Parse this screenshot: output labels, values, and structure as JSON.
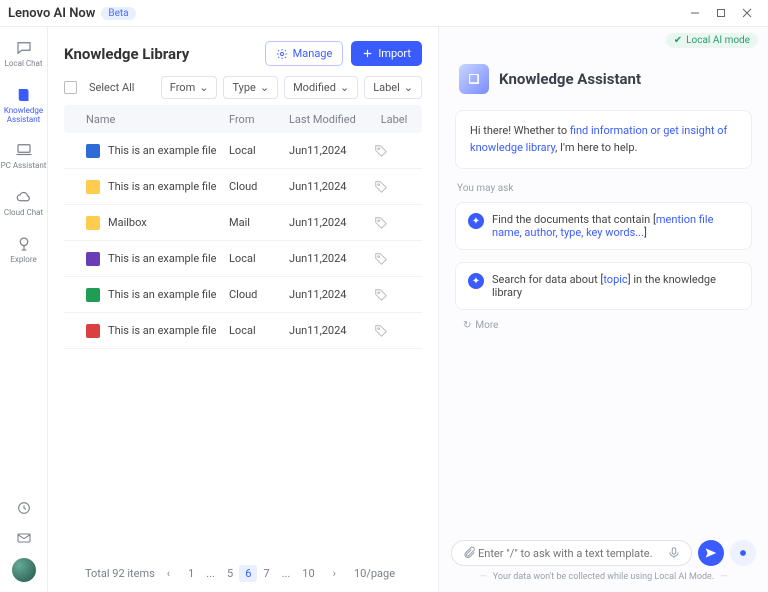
{
  "titlebar": {
    "brand": "Lenovo AI Now",
    "beta": "Beta"
  },
  "sidebar": {
    "items": [
      {
        "label": "Local Chat"
      },
      {
        "label": "Knowledge Assistant"
      },
      {
        "label": "PC Assistant"
      },
      {
        "label": "Cloud Chat"
      },
      {
        "label": "Explore"
      }
    ]
  },
  "page": {
    "title": "Knowledge Library",
    "manage": "Manage",
    "import": "Import",
    "select_all": "Select All",
    "filters": {
      "from": "From",
      "type": "Type",
      "modified": "Modified",
      "label": "Label"
    },
    "columns": {
      "name": "Name",
      "from": "From",
      "modified": "Last Modified",
      "label": "Label"
    },
    "rows": [
      {
        "icon": "word",
        "name": "This is an example file",
        "from": "Local",
        "modified": "Jun11,2024"
      },
      {
        "icon": "folder",
        "name": "This is an example file",
        "from": "Cloud",
        "modified": "Jun11,2024"
      },
      {
        "icon": "folder",
        "name": "Mailbox",
        "from": "Mail",
        "modified": "Jun11,2024"
      },
      {
        "icon": "one",
        "name": "This is an example file",
        "from": "Local",
        "modified": "Jun11,2024"
      },
      {
        "icon": "excel",
        "name": "This is an example file",
        "from": "Cloud",
        "modified": "Jun11,2024"
      },
      {
        "icon": "pdf",
        "name": "This is an example file",
        "from": "Local",
        "modified": "Jun11,2024"
      }
    ],
    "pagination": {
      "total": "Total 92 items",
      "pages": [
        "1",
        "...",
        "5",
        "6",
        "7",
        "...",
        "10"
      ],
      "current": "6",
      "per": "10/page"
    }
  },
  "chat": {
    "mode": "Local AI mode",
    "title": "Knowledge Assistant",
    "greeting_pre": "Hi there!  Whether to ",
    "greeting_link": "find information or get insight of knowledge library",
    "greeting_post": ", I'm here to help.",
    "you_may_ask": "You may ask",
    "sugg1_pre": "Find the documents that contain [",
    "sugg1_hint": "mention file name, author, type, key words...",
    "sugg1_post": "]",
    "sugg2_pre": "Search for data about [",
    "sugg2_hint": "topic",
    "sugg2_post": "] in the knowledge library",
    "more": "More",
    "placeholder": "Enter \"/\" to ask with a text template.",
    "disclaimer": "Your data won't be collected while using  Local AI Mode."
  }
}
